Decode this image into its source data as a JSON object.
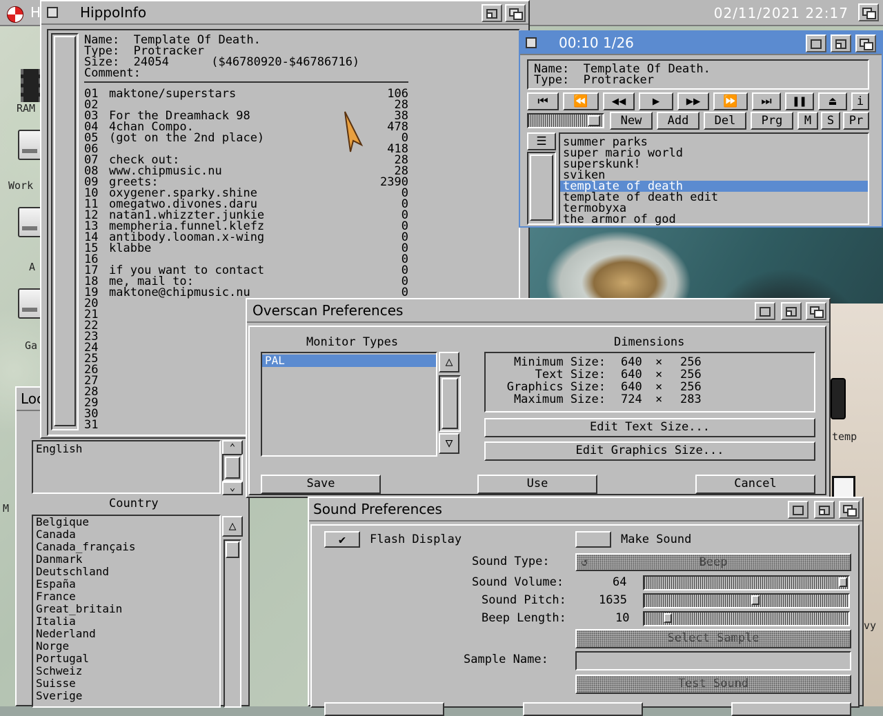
{
  "screen": {
    "title_fragment": "H",
    "clock": "02/11/2021 22:17"
  },
  "desktop_icons": [
    {
      "label": "RAM"
    },
    {
      "label": "Work"
    },
    {
      "label": "A"
    },
    {
      "label": "Ga"
    },
    {
      "label": "M"
    },
    {
      "label": "temp"
    },
    {
      "label": "vy"
    }
  ],
  "hippoinfo": {
    "title": "HippoInfo",
    "header": "Name:  Template Of Death.\nType:  Protracker\nSize:  24054      ($46780920-$46786716)\nComment:",
    "samples": [
      {
        "num": "01",
        "name": "maktone/superstars",
        "size": "106"
      },
      {
        "num": "02",
        "name": "",
        "size": "28"
      },
      {
        "num": "03",
        "name": "For the Dreamhack 98",
        "size": "38"
      },
      {
        "num": "04",
        "name": "4chan Compo.",
        "size": "478"
      },
      {
        "num": "05",
        "name": "(got on the 2nd place)",
        "size": "0"
      },
      {
        "num": "06",
        "name": "",
        "size": "418"
      },
      {
        "num": "07",
        "name": "check out:",
        "size": "28"
      },
      {
        "num": "08",
        "name": "www.chipmusic.nu",
        "size": "28"
      },
      {
        "num": "09",
        "name": "greets:",
        "size": "2390"
      },
      {
        "num": "10",
        "name": "oxygener.sparky.shine",
        "size": "0"
      },
      {
        "num": "11",
        "name": "omegatwo.divones.daru",
        "size": "0"
      },
      {
        "num": "12",
        "name": "natan1.whizzter.junkie",
        "size": "0"
      },
      {
        "num": "13",
        "name": "mempheria.funnel.klefz",
        "size": "0"
      },
      {
        "num": "14",
        "name": "antibody.looman.x-wing",
        "size": "0"
      },
      {
        "num": "15",
        "name": "klabbe",
        "size": "0"
      },
      {
        "num": "16",
        "name": "",
        "size": "0"
      },
      {
        "num": "17",
        "name": "if you want to contact",
        "size": "0"
      },
      {
        "num": "18",
        "name": "me, mail to:",
        "size": "0"
      },
      {
        "num": "19",
        "name": "maktone@chipmusic.nu",
        "size": "0"
      },
      {
        "num": "20",
        "name": "",
        "size": ""
      },
      {
        "num": "21",
        "name": "",
        "size": ""
      },
      {
        "num": "22",
        "name": "",
        "size": ""
      },
      {
        "num": "23",
        "name": "",
        "size": ""
      },
      {
        "num": "24",
        "name": "",
        "size": ""
      },
      {
        "num": "25",
        "name": "",
        "size": ""
      },
      {
        "num": "26",
        "name": "",
        "size": ""
      },
      {
        "num": "27",
        "name": "",
        "size": ""
      },
      {
        "num": "28",
        "name": "",
        "size": ""
      },
      {
        "num": "29",
        "name": "",
        "size": ""
      },
      {
        "num": "30",
        "name": "",
        "size": ""
      },
      {
        "num": "31",
        "name": "",
        "size": ""
      }
    ]
  },
  "player": {
    "title": "00:10 1/26",
    "name_line": "Name:  Template Of Death.",
    "type_line": "Type:  Protracker",
    "transport": [
      "first-icon",
      "rewind-icon",
      "play-icon",
      "forward-icon",
      "skip-icon",
      "last-icon",
      "pause-icon",
      "eject-icon",
      "info-icon"
    ],
    "buttons": {
      "new": "New",
      "add": "Add",
      "del": "Del",
      "prg": "Prg",
      "m": "M",
      "s": "S",
      "pr": "Pr"
    },
    "playlist": [
      "summer parks",
      "super mario world",
      "superskunk!",
      "sviken",
      "template of death",
      "template of death edit",
      "termobyxa",
      "the armor of god"
    ],
    "selected_index": 4
  },
  "locale": {
    "title_fragment": "Loc",
    "languages": [
      "English"
    ],
    "country_heading": "Country",
    "countries": [
      "Belgique",
      "Canada",
      "Canada_français",
      "Danmark",
      "Deutschland",
      "España",
      "France",
      "Great_britain",
      "Italia",
      "Nederland",
      "Norge",
      "Portugal",
      "Schweiz",
      "Suisse",
      "Sverige"
    ]
  },
  "overscan": {
    "title": "Overscan Preferences",
    "monitor_heading": "Monitor Types",
    "monitors": [
      "PAL"
    ],
    "dimensions_heading": "Dimensions",
    "dims": [
      {
        "label": "Minimum Size:",
        "w": "640",
        "x": "×",
        "h": "256"
      },
      {
        "label": "Text Size:",
        "w": "640",
        "x": "×",
        "h": "256"
      },
      {
        "label": "Graphics Size:",
        "w": "640",
        "x": "×",
        "h": "256"
      },
      {
        "label": "Maximum Size:",
        "w": "724",
        "x": "×",
        "h": "283"
      }
    ],
    "edit_text": "Edit Text Size...",
    "edit_graphics": "Edit Graphics Size...",
    "save": "Save",
    "use": "Use",
    "cancel": "Cancel"
  },
  "sound": {
    "title": "Sound Preferences",
    "flash_display": "Flash Display",
    "flash_checked": true,
    "make_sound": "Make Sound",
    "make_checked": false,
    "sound_type_label": "Sound Type:",
    "sound_type_value": "Beep",
    "volume_label": "Sound Volume:",
    "volume_value": "64",
    "volume_fraction": 1.0,
    "pitch_label": "Sound Pitch:",
    "pitch_value": "1635",
    "pitch_fraction": 0.55,
    "length_label": "Beep Length:",
    "length_value": "10",
    "length_fraction": 0.1,
    "select_sample": "Select Sample",
    "sample_name_label": "Sample Name:",
    "sample_name_value": "",
    "test_sound": "Test Sound"
  }
}
